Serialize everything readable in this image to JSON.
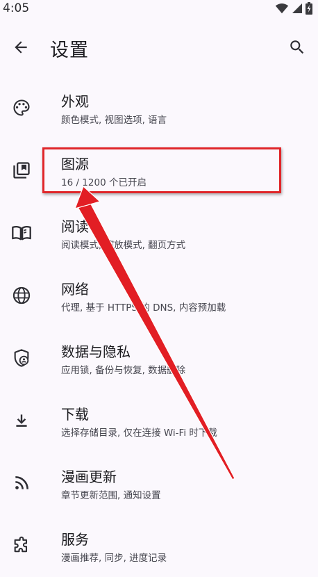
{
  "status_bar": {
    "time": "4:05"
  },
  "app_bar": {
    "title": "设置",
    "back_icon": "arrow-back-icon",
    "search_icon": "search-icon"
  },
  "colors": {
    "background": "#fbf8fd",
    "highlight": "#e0262a",
    "icon": "#2e2e34"
  },
  "settings": [
    {
      "title": "外观",
      "subtitle": "颜色模式, 视图选项, 语言",
      "icon": "palette-icon"
    },
    {
      "title": "图源",
      "subtitle": "16 / 1200 个已开启",
      "icon": "library-icon"
    },
    {
      "title": "阅读",
      "subtitle": "阅读模式, 缩放模式, 翻页方式",
      "icon": "book-open-icon"
    },
    {
      "title": "网络",
      "subtitle": "代理, 基于 HTTPS 的 DNS, 内容预加载",
      "icon": "globe-icon"
    },
    {
      "title": "数据与隐私",
      "subtitle": "应用锁, 备份与恢复, 数据删除",
      "icon": "shield-user-icon"
    },
    {
      "title": "下载",
      "subtitle": "选择存储目录, 仅在连接 Wi-Fi 时下载",
      "icon": "download-icon"
    },
    {
      "title": "漫画更新",
      "subtitle": "章节更新范围, 通知设置",
      "icon": "rss-icon"
    },
    {
      "title": "服务",
      "subtitle": "漫画推荐, 同步, 进度记录",
      "icon": "puzzle-icon"
    }
  ]
}
